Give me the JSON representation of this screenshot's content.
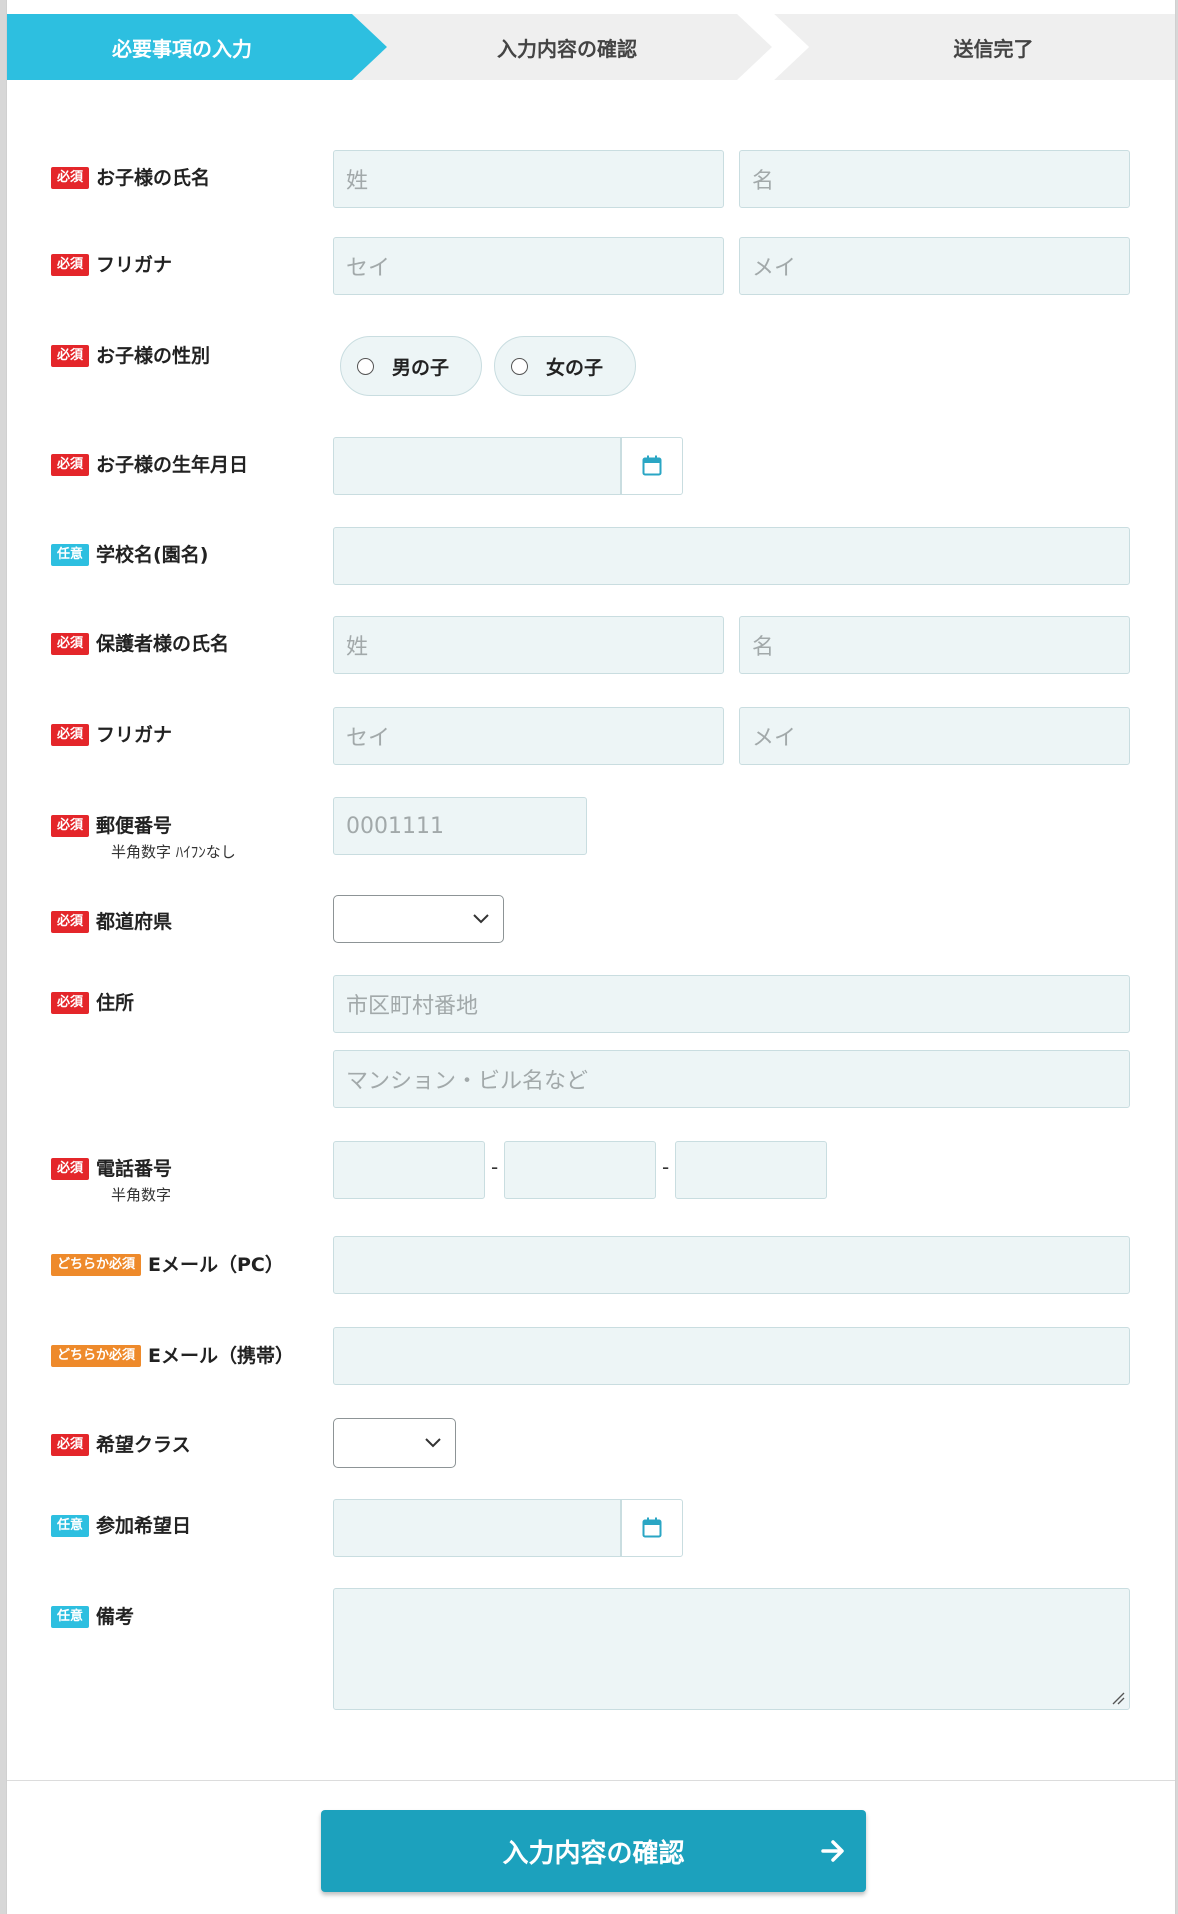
{
  "steps": [
    {
      "label": "必要事項の入力",
      "active": true
    },
    {
      "label": "入力内容の確認",
      "active": false
    },
    {
      "label": "送信完了",
      "active": false
    }
  ],
  "badges": {
    "required": "必須",
    "optional": "任意",
    "either": "どちらか必須"
  },
  "fields": {
    "child_name": {
      "label": "お子様の氏名",
      "last_placeholder": "姓",
      "first_placeholder": "名"
    },
    "child_kana": {
      "label": "フリガナ",
      "last_placeholder": "セイ",
      "first_placeholder": "メイ"
    },
    "child_gender": {
      "label": "お子様の性別",
      "options": [
        "男の子",
        "女の子"
      ]
    },
    "child_birthday": {
      "label": "お子様の生年月日"
    },
    "school": {
      "label": "学校名(園名)"
    },
    "guardian_name": {
      "label": "保護者様の氏名",
      "last_placeholder": "姓",
      "first_placeholder": "名"
    },
    "guardian_kana": {
      "label": "フリガナ",
      "last_placeholder": "セイ",
      "first_placeholder": "メイ"
    },
    "postal": {
      "label": "郵便番号",
      "note": "半角数字 ﾊｲﾌﾝなし",
      "placeholder": "0001111"
    },
    "prefecture": {
      "label": "都道府県",
      "value": ""
    },
    "address": {
      "label": "住所",
      "line1_placeholder": "市区町村番地",
      "line2_placeholder": "マンション・ビル名など"
    },
    "phone": {
      "label": "電話番号",
      "note": "半角数字",
      "separator": "-"
    },
    "email_pc": {
      "label": "Eメール（PC）"
    },
    "email_mobile": {
      "label": "Eメール（携帯）"
    },
    "class": {
      "label": "希望クラス",
      "value": ""
    },
    "date": {
      "label": "参加希望日"
    },
    "remarks": {
      "label": "備考"
    }
  },
  "submit": {
    "label": "入力内容の確認"
  },
  "colors": {
    "accent": "#2dbfe0",
    "required": "#e4262a",
    "either": "#ee8a2b",
    "button": "#1ca1bd"
  }
}
